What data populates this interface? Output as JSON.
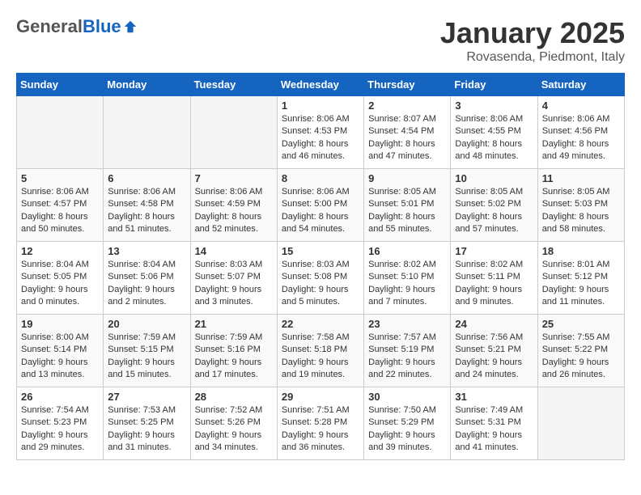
{
  "header": {
    "logo_general": "General",
    "logo_blue": "Blue",
    "month": "January 2025",
    "location": "Rovasenda, Piedmont, Italy"
  },
  "weekdays": [
    "Sunday",
    "Monday",
    "Tuesday",
    "Wednesday",
    "Thursday",
    "Friday",
    "Saturday"
  ],
  "weeks": [
    [
      {
        "day": "",
        "info": ""
      },
      {
        "day": "",
        "info": ""
      },
      {
        "day": "",
        "info": ""
      },
      {
        "day": "1",
        "info": "Sunrise: 8:06 AM\nSunset: 4:53 PM\nDaylight: 8 hours and 46 minutes."
      },
      {
        "day": "2",
        "info": "Sunrise: 8:07 AM\nSunset: 4:54 PM\nDaylight: 8 hours and 47 minutes."
      },
      {
        "day": "3",
        "info": "Sunrise: 8:06 AM\nSunset: 4:55 PM\nDaylight: 8 hours and 48 minutes."
      },
      {
        "day": "4",
        "info": "Sunrise: 8:06 AM\nSunset: 4:56 PM\nDaylight: 8 hours and 49 minutes."
      }
    ],
    [
      {
        "day": "5",
        "info": "Sunrise: 8:06 AM\nSunset: 4:57 PM\nDaylight: 8 hours and 50 minutes."
      },
      {
        "day": "6",
        "info": "Sunrise: 8:06 AM\nSunset: 4:58 PM\nDaylight: 8 hours and 51 minutes."
      },
      {
        "day": "7",
        "info": "Sunrise: 8:06 AM\nSunset: 4:59 PM\nDaylight: 8 hours and 52 minutes."
      },
      {
        "day": "8",
        "info": "Sunrise: 8:06 AM\nSunset: 5:00 PM\nDaylight: 8 hours and 54 minutes."
      },
      {
        "day": "9",
        "info": "Sunrise: 8:05 AM\nSunset: 5:01 PM\nDaylight: 8 hours and 55 minutes."
      },
      {
        "day": "10",
        "info": "Sunrise: 8:05 AM\nSunset: 5:02 PM\nDaylight: 8 hours and 57 minutes."
      },
      {
        "day": "11",
        "info": "Sunrise: 8:05 AM\nSunset: 5:03 PM\nDaylight: 8 hours and 58 minutes."
      }
    ],
    [
      {
        "day": "12",
        "info": "Sunrise: 8:04 AM\nSunset: 5:05 PM\nDaylight: 9 hours and 0 minutes."
      },
      {
        "day": "13",
        "info": "Sunrise: 8:04 AM\nSunset: 5:06 PM\nDaylight: 9 hours and 2 minutes."
      },
      {
        "day": "14",
        "info": "Sunrise: 8:03 AM\nSunset: 5:07 PM\nDaylight: 9 hours and 3 minutes."
      },
      {
        "day": "15",
        "info": "Sunrise: 8:03 AM\nSunset: 5:08 PM\nDaylight: 9 hours and 5 minutes."
      },
      {
        "day": "16",
        "info": "Sunrise: 8:02 AM\nSunset: 5:10 PM\nDaylight: 9 hours and 7 minutes."
      },
      {
        "day": "17",
        "info": "Sunrise: 8:02 AM\nSunset: 5:11 PM\nDaylight: 9 hours and 9 minutes."
      },
      {
        "day": "18",
        "info": "Sunrise: 8:01 AM\nSunset: 5:12 PM\nDaylight: 9 hours and 11 minutes."
      }
    ],
    [
      {
        "day": "19",
        "info": "Sunrise: 8:00 AM\nSunset: 5:14 PM\nDaylight: 9 hours and 13 minutes."
      },
      {
        "day": "20",
        "info": "Sunrise: 7:59 AM\nSunset: 5:15 PM\nDaylight: 9 hours and 15 minutes."
      },
      {
        "day": "21",
        "info": "Sunrise: 7:59 AM\nSunset: 5:16 PM\nDaylight: 9 hours and 17 minutes."
      },
      {
        "day": "22",
        "info": "Sunrise: 7:58 AM\nSunset: 5:18 PM\nDaylight: 9 hours and 19 minutes."
      },
      {
        "day": "23",
        "info": "Sunrise: 7:57 AM\nSunset: 5:19 PM\nDaylight: 9 hours and 22 minutes."
      },
      {
        "day": "24",
        "info": "Sunrise: 7:56 AM\nSunset: 5:21 PM\nDaylight: 9 hours and 24 minutes."
      },
      {
        "day": "25",
        "info": "Sunrise: 7:55 AM\nSunset: 5:22 PM\nDaylight: 9 hours and 26 minutes."
      }
    ],
    [
      {
        "day": "26",
        "info": "Sunrise: 7:54 AM\nSunset: 5:23 PM\nDaylight: 9 hours and 29 minutes."
      },
      {
        "day": "27",
        "info": "Sunrise: 7:53 AM\nSunset: 5:25 PM\nDaylight: 9 hours and 31 minutes."
      },
      {
        "day": "28",
        "info": "Sunrise: 7:52 AM\nSunset: 5:26 PM\nDaylight: 9 hours and 34 minutes."
      },
      {
        "day": "29",
        "info": "Sunrise: 7:51 AM\nSunset: 5:28 PM\nDaylight: 9 hours and 36 minutes."
      },
      {
        "day": "30",
        "info": "Sunrise: 7:50 AM\nSunset: 5:29 PM\nDaylight: 9 hours and 39 minutes."
      },
      {
        "day": "31",
        "info": "Sunrise: 7:49 AM\nSunset: 5:31 PM\nDaylight: 9 hours and 41 minutes."
      },
      {
        "day": "",
        "info": ""
      }
    ]
  ]
}
